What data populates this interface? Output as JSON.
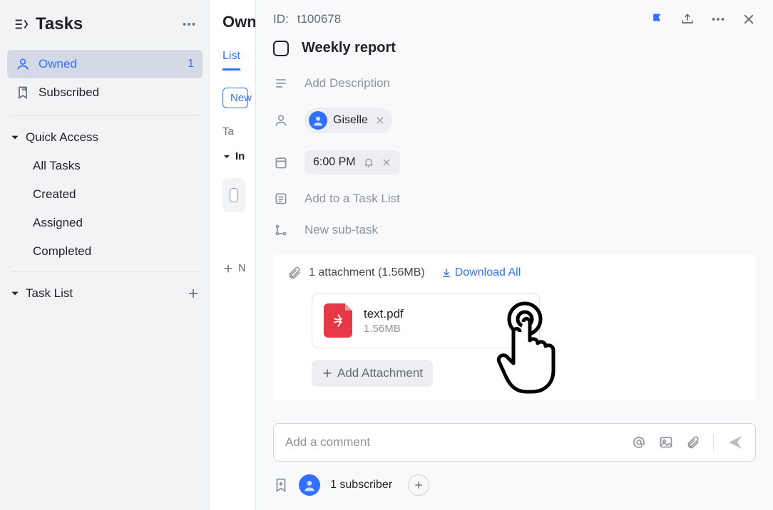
{
  "sidebar": {
    "title": "Tasks",
    "nav": [
      {
        "label": "Owned",
        "badge": "1",
        "active": true
      },
      {
        "label": "Subscribed",
        "active": false
      }
    ],
    "quick_access": {
      "label": "Quick Access",
      "items": [
        "All Tasks",
        "Created",
        "Assigned",
        "Completed"
      ]
    },
    "task_list_label": "Task List"
  },
  "middle": {
    "title": "Owned",
    "tab": "List",
    "new_btn": "New",
    "group_col": "Ta",
    "section_label": "In",
    "new_section": "N"
  },
  "panel": {
    "id_label": "ID:",
    "id_value": "t100678",
    "task_title": "Weekly report",
    "desc_placeholder": "Add Description",
    "assignee": "Giselle",
    "time": "6:00 PM",
    "add_tasklist": "Add to a Task List",
    "new_subtask": "New sub-task",
    "attach_summary": "1 attachment (1.56MB)",
    "download_all": "Download All",
    "file": {
      "name": "text.pdf",
      "size": "1.56MB"
    },
    "add_attachment": "Add Attachment",
    "comment_placeholder": "Add a comment",
    "subscriber_label": "1 subscriber"
  }
}
